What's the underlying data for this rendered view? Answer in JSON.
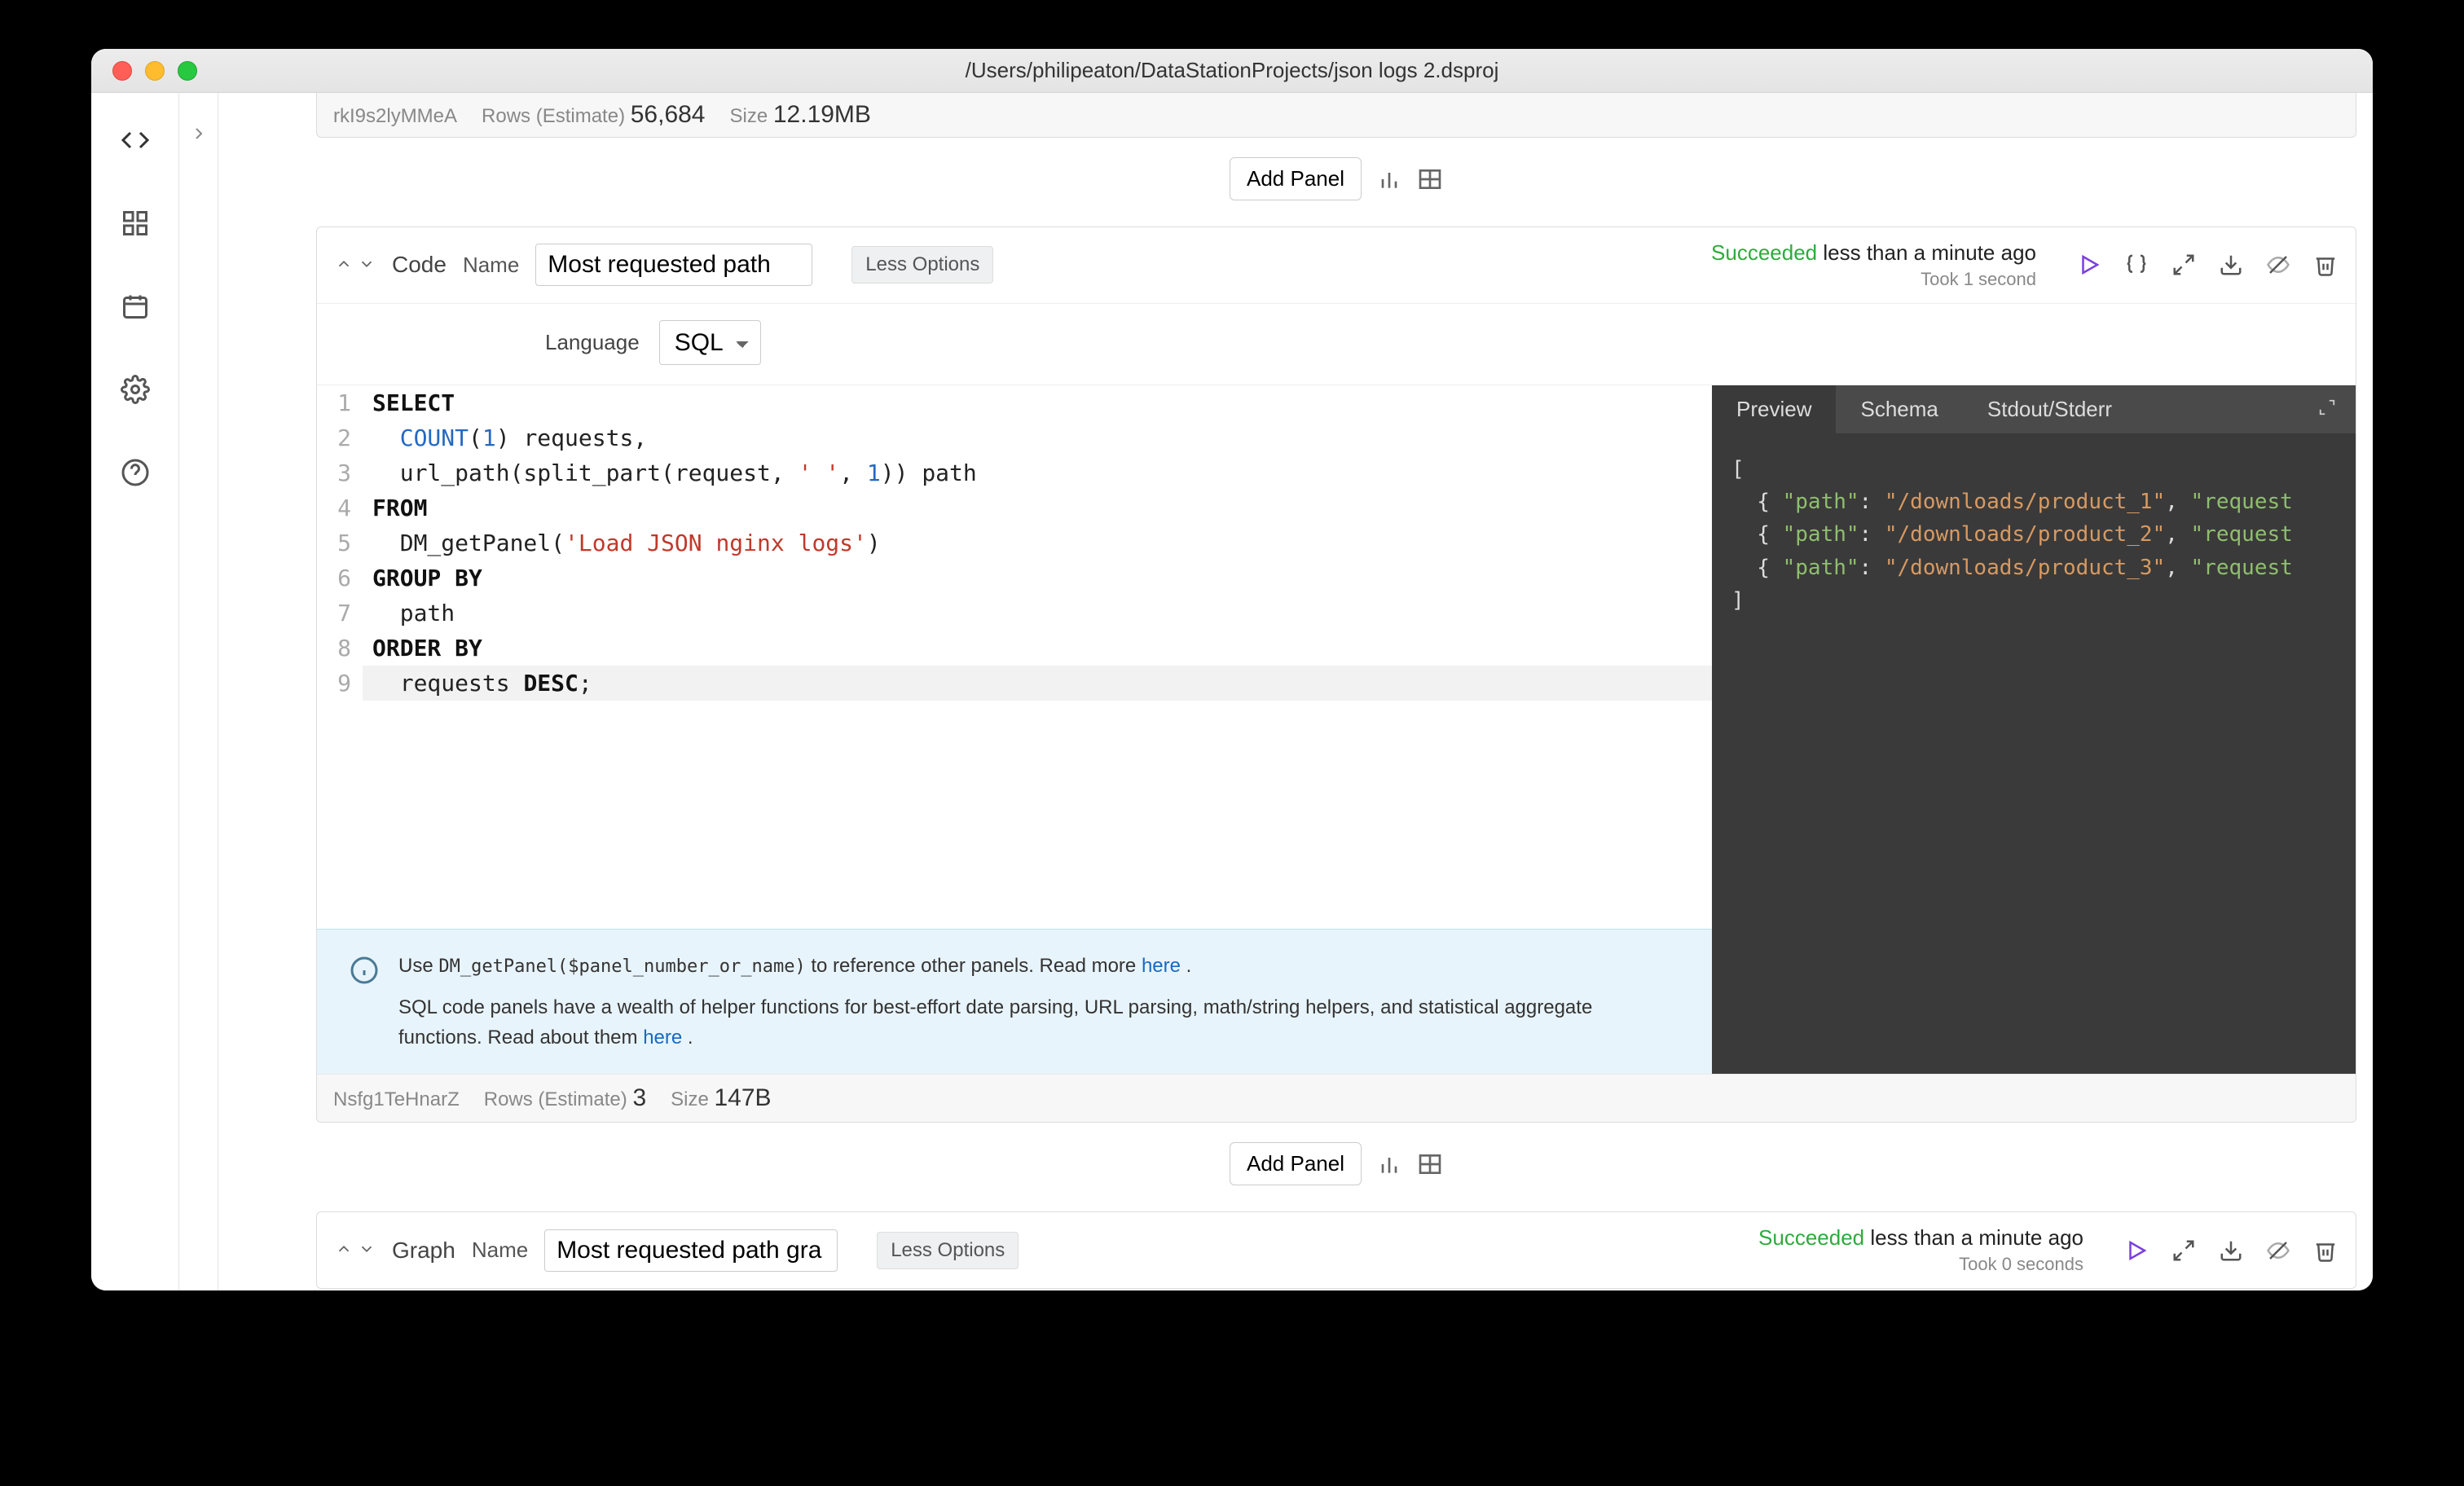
{
  "window_title": "/Users/philipeaton/DataStationProjects/json logs 2.dsproj",
  "prev_panel_footer": {
    "id": "rkI9s2lyMMeA",
    "rows_label": "Rows (Estimate)",
    "rows": "56,684",
    "size_label": "Size",
    "size": "12.19MB"
  },
  "add_panel_label": "Add Panel",
  "panel1": {
    "type_label": "Code",
    "name_label": "Name",
    "name_value": "Most requested path",
    "less_options": "Less Options",
    "status_ok": "Succeeded",
    "status_time": "less than a minute ago",
    "status_duration": "Took 1 second",
    "language_label": "Language",
    "language_value": "SQL",
    "footer": {
      "id": "Nsfg1TeHnarZ",
      "rows_label": "Rows (Estimate)",
      "rows": "3",
      "size_label": "Size",
      "size": "147B"
    }
  },
  "code_lines": [
    {
      "n": "1",
      "t": "SELECT",
      "cls": "kw"
    },
    {
      "n": "2",
      "t": "  COUNT(1) requests,",
      "render": "fn"
    },
    {
      "n": "3",
      "t": "  url_path(split_part(request, ' ', 1)) path"
    },
    {
      "n": "4",
      "t": "FROM",
      "cls": "kw"
    },
    {
      "n": "5",
      "t": "  DM_getPanel('Load JSON nginx logs')"
    },
    {
      "n": "6",
      "t": "GROUP BY",
      "cls": "kw"
    },
    {
      "n": "7",
      "t": "  path"
    },
    {
      "n": "8",
      "t": "ORDER BY",
      "cls": "kw"
    },
    {
      "n": "9",
      "t": "  requests DESC;"
    }
  ],
  "info": {
    "line1_a": "Use ",
    "line1_code": "DM_getPanel($panel_number_or_name)",
    "line1_b": " to reference other panels. Read more ",
    "line1_link": "here",
    "line2_a": "SQL code panels have a wealth of helper functions for best-effort date parsing, URL parsing, math/string helpers, and statistical aggregate functions. Read about them ",
    "line2_link": "here"
  },
  "preview_tabs": {
    "preview": "Preview",
    "schema": "Schema",
    "stdout": "Stdout/Stderr"
  },
  "preview_rows": [
    {
      "path": "/downloads/product_1",
      "tail": ", \"request"
    },
    {
      "path": "/downloads/product_2",
      "tail": ", \"request"
    },
    {
      "path": "/downloads/product_3",
      "tail": ", \"request"
    }
  ],
  "panel2": {
    "type_label": "Graph",
    "name_label": "Name",
    "name_value": "Most requested path gra",
    "less_options": "Less Options",
    "status_ok": "Succeeded",
    "status_time": "less than a minute ago",
    "status_duration": "Took 0 seconds"
  }
}
